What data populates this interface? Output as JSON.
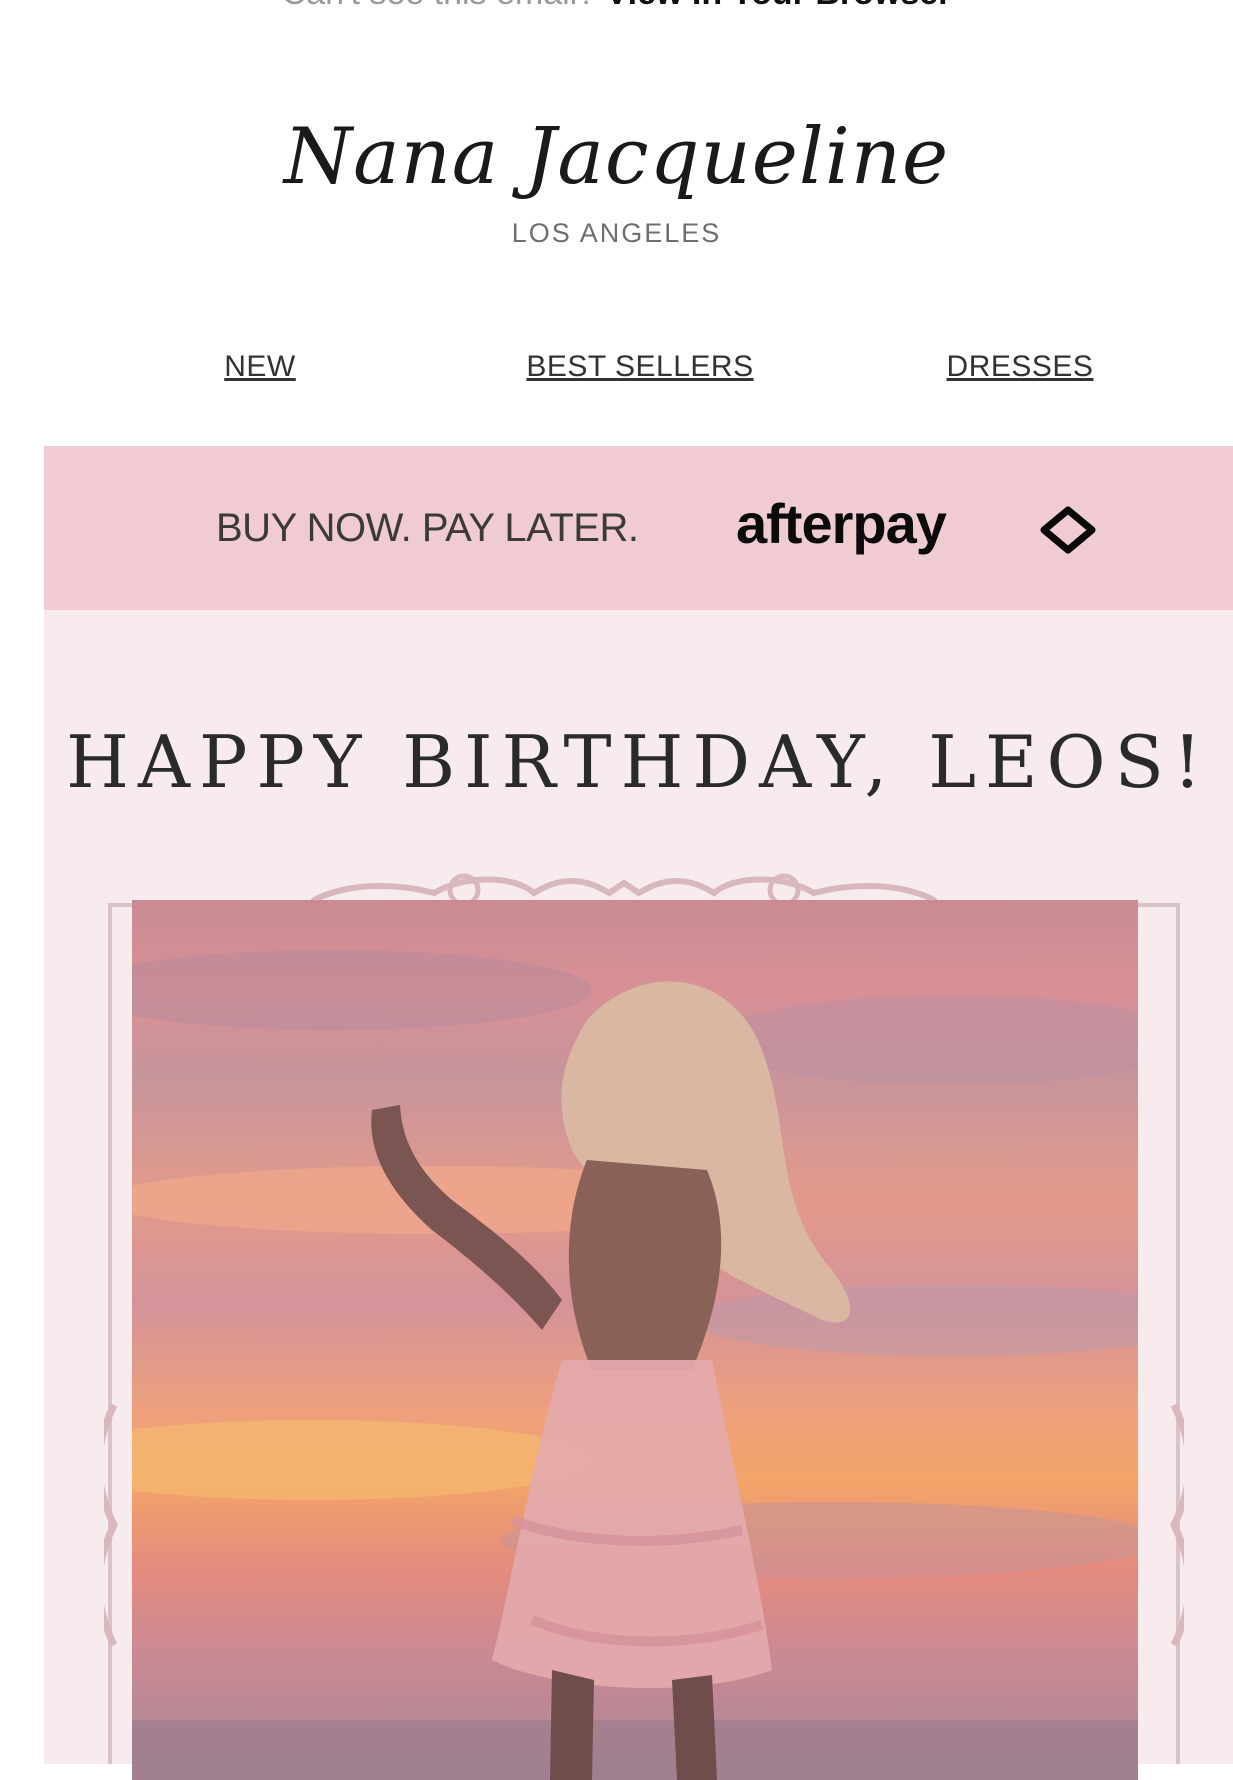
{
  "preheader": {
    "text": "Can't see this email?",
    "link": "View In Your Browser"
  },
  "brand": {
    "name": "Nana Jacqueline",
    "location": "LOS ANGELES"
  },
  "nav": [
    {
      "label": "NEW"
    },
    {
      "label": "BEST SELLERS"
    },
    {
      "label": "DRESSES"
    }
  ],
  "afterpay_banner": {
    "tagline": "BUY NOW. PAY LATER.",
    "logo_text": "afterpay"
  },
  "hero": {
    "headline": "HAPPY BIRTHDAY, LEOS!"
  },
  "colors": {
    "band_pink": "#f0ccd2",
    "hero_background": "#f8ebee",
    "frame_pink": "#c9a9b2"
  }
}
